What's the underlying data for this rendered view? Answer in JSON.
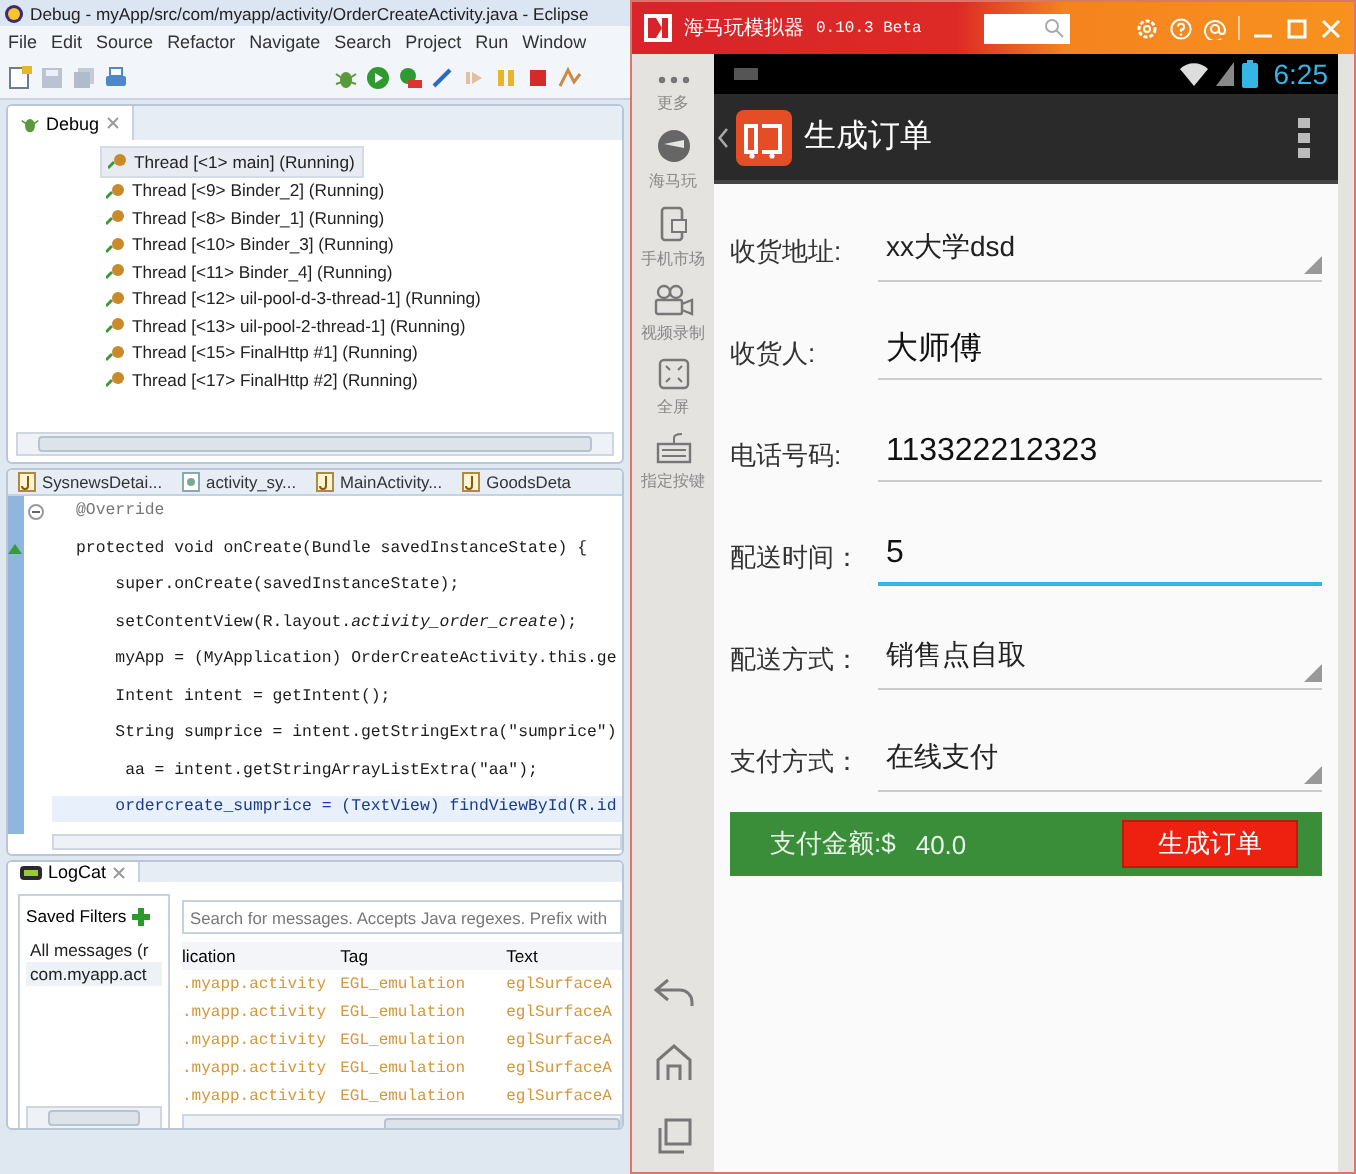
{
  "eclipse": {
    "window": {
      "title": "Debug - myApp/src/com/myapp/activity/OrderCreateActivity.java - Eclipse"
    },
    "menu": [
      "File",
      "Edit",
      "Source",
      "Refactor",
      "Navigate",
      "Search",
      "Project",
      "Run",
      "Window"
    ],
    "debug": {
      "tab": "Debug",
      "threads": [
        {
          "label": "Thread [<1> main] (Running)",
          "selected": true
        },
        {
          "label": "Thread [<9> Binder_2] (Running)",
          "selected": false
        },
        {
          "label": "Thread [<8> Binder_1] (Running)",
          "selected": false
        },
        {
          "label": "Thread [<10> Binder_3] (Running)",
          "selected": false
        },
        {
          "label": "Thread [<11> Binder_4] (Running)",
          "selected": false
        },
        {
          "label": "Thread [<12> uil-pool-d-3-thread-1] (Running)",
          "selected": false
        },
        {
          "label": "Thread [<13> uil-pool-2-thread-1] (Running)",
          "selected": false
        },
        {
          "label": "Thread [<15> FinalHttp #1] (Running)",
          "selected": false
        },
        {
          "label": "Thread [<17> FinalHttp #2] (Running)",
          "selected": false
        }
      ]
    },
    "editor": {
      "tabs": [
        {
          "label": "SysnewsDetai...",
          "kind": "java",
          "selected": false
        },
        {
          "label": "activity_sy...",
          "kind": "xml",
          "selected": false
        },
        {
          "label": "MainActivity...",
          "kind": "java",
          "selected": false
        },
        {
          "label": "GoodsDeta",
          "kind": "java",
          "selected": false
        }
      ],
      "lines": [
        {
          "text": "@Override",
          "kind": "annotation"
        },
        {
          "text": "protected void onCreate(Bundle savedInstanceState) {",
          "kind": "code"
        },
        {
          "text": "    super.onCreate(savedInstanceState);",
          "kind": "code"
        },
        {
          "text": "    setContentView(R.layout.*activity_order_create*);",
          "kind": "code"
        },
        {
          "text": "    myApp = (MyApplication) OrderCreateActivity.this.ge",
          "kind": "code"
        },
        {
          "text": "    Intent intent = getIntent();",
          "kind": "code"
        },
        {
          "text": "    String sumprice = intent.getStringExtra(\"sumprice\")",
          "kind": "code"
        },
        {
          "text": "     aa = intent.getStringArrayListExtra(\"aa\");",
          "kind": "code"
        },
        {
          "text": "    ordercreate_sumprice = (TextView) findViewById(R.id",
          "kind": "current"
        }
      ]
    },
    "logcat": {
      "tab": "LogCat",
      "filters_title": "Saved Filters",
      "filters": [
        {
          "label": "All messages (r",
          "selected": false
        },
        {
          "label": "com.myapp.act",
          "selected": true
        }
      ],
      "search": {
        "placeholder": "Search for messages. Accepts Java regexes. Prefix with"
      },
      "columns": [
        "lication",
        "Tag",
        "Text"
      ],
      "rows": [
        [
          ".myapp.activity",
          "EGL_emulation",
          "eglSurfaceA"
        ],
        [
          ".myapp.activity",
          "EGL_emulation",
          "eglSurfaceA"
        ],
        [
          ".myapp.activity",
          "EGL_emulation",
          "eglSurfaceA"
        ],
        [
          ".myapp.activity",
          "EGL_emulation",
          "eglSurfaceA"
        ],
        [
          ".myapp.activity",
          "EGL_emulation",
          "eglSurfaceA"
        ]
      ]
    }
  },
  "emulator": {
    "title": "海马玩模拟器",
    "version": "0.10.3 Beta",
    "sidebar": [
      {
        "label": "更多",
        "kind": "dots"
      },
      {
        "label": "海马玩",
        "kind": "hippo"
      },
      {
        "label": "手机市场",
        "kind": "phone"
      },
      {
        "label": "视频录制",
        "kind": "camera"
      },
      {
        "label": "全屏",
        "kind": "fullscreen"
      },
      {
        "label": "指定按键",
        "kind": "keys"
      }
    ],
    "clock": "6:25",
    "app_title": "生成订单",
    "fields": [
      {
        "label": "收货地址:",
        "value": "xx大学dsd",
        "kind": "spinner",
        "focused": false
      },
      {
        "label": "收货人:",
        "value": "大师傅",
        "kind": "text",
        "focused": false
      },
      {
        "label": "电话号码:",
        "value": "113322212323",
        "kind": "text",
        "focused": false
      },
      {
        "label": "配送时间：",
        "value": "5",
        "kind": "text",
        "focused": true
      },
      {
        "label": "配送方式：",
        "value": "销售点自取",
        "kind": "spinner",
        "focused": false
      },
      {
        "label": "支付方式：",
        "value": "在线支付",
        "kind": "spinner",
        "focused": false
      }
    ],
    "pay_label": "支付金额:$",
    "pay_amount": "40.0",
    "submit": "生成订单"
  }
}
